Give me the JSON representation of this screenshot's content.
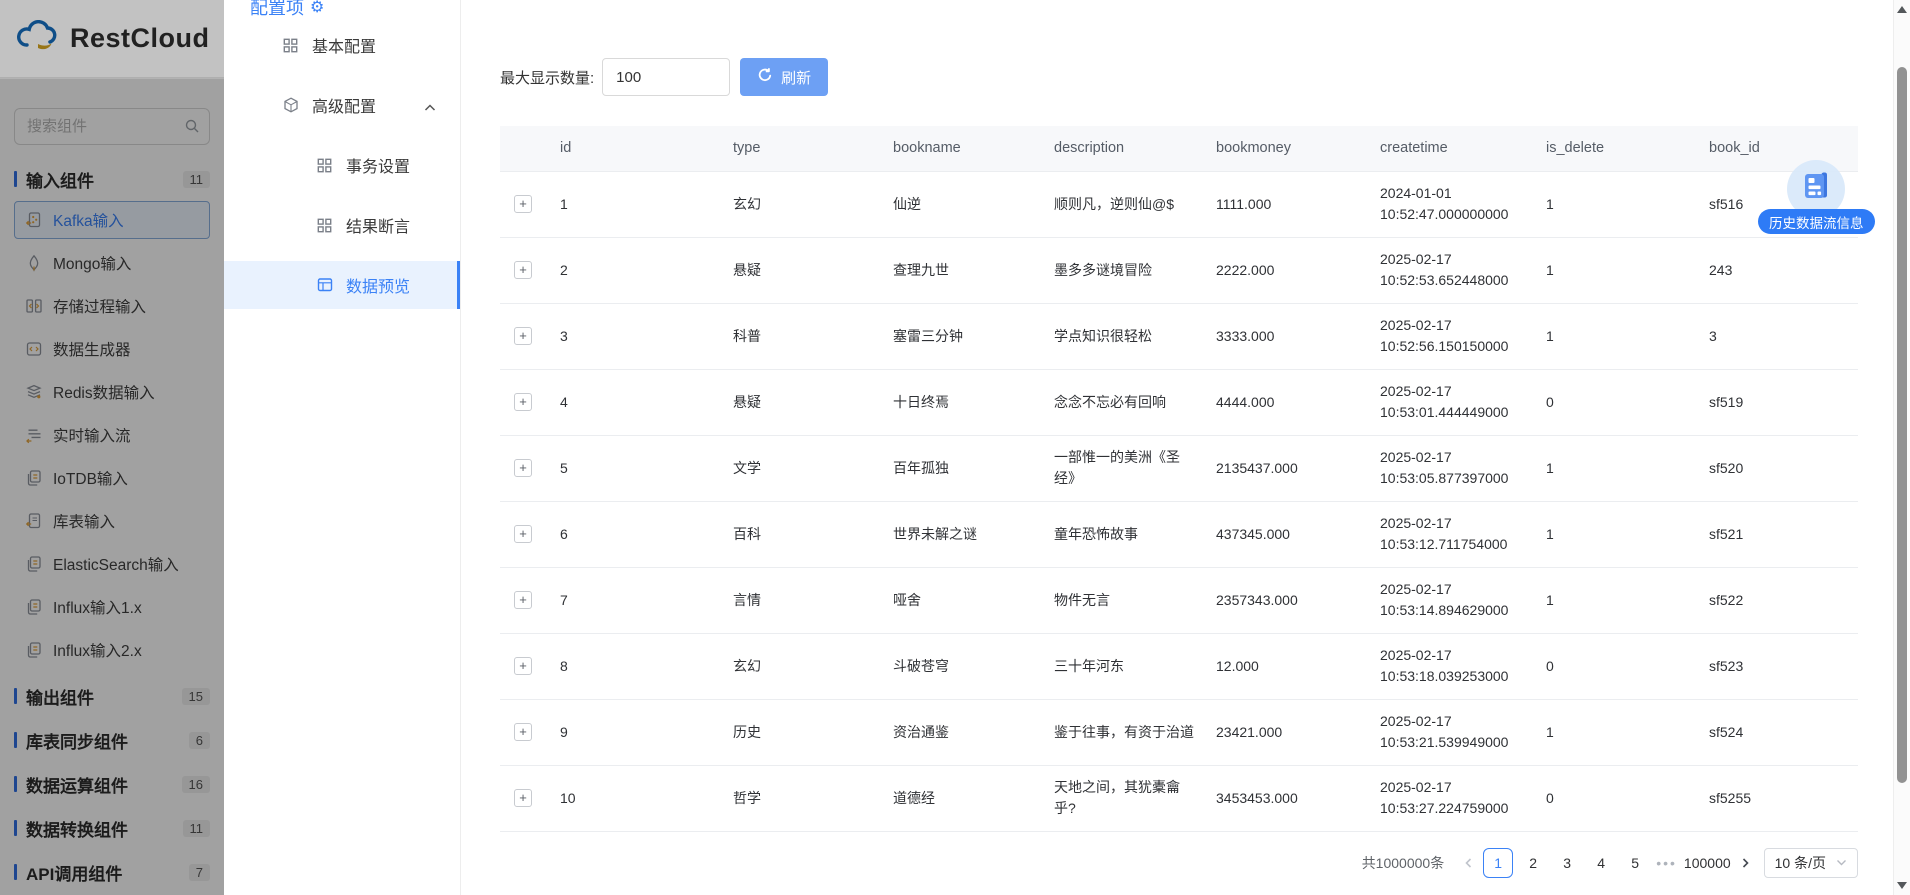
{
  "brand": {
    "name": "RestCloud"
  },
  "colors": {
    "accent_blue": "#3b82f6",
    "refresh_button_blue": "#6da0f4",
    "badge_blue": "#2e7bf6",
    "active_item_bg": "#e9f2fe",
    "table_header_bg": "#f7f8fa"
  },
  "sidebar": {
    "search_placeholder": "搜索组件",
    "sections": [
      {
        "name": "input-components",
        "label": "输入组件",
        "count": "11",
        "items": [
          {
            "name": "kafka-input",
            "label": "Kafka输入",
            "icon": "kafka-input-icon",
            "active": true
          },
          {
            "name": "mongo-input",
            "label": "Mongo输入",
            "icon": "mongo-input-icon"
          },
          {
            "name": "stored-procedure-input",
            "label": "存储过程输入",
            "icon": "stored-procedure-input-icon"
          },
          {
            "name": "data-generator",
            "label": "数据生成器",
            "icon": "data-generator-icon"
          },
          {
            "name": "redis-input",
            "label": "Redis数据输入",
            "icon": "redis-input-icon"
          },
          {
            "name": "realtime-stream-input",
            "label": "实时输入流",
            "icon": "realtime-stream-icon"
          },
          {
            "name": "iotdb-input",
            "label": "IoTDB输入",
            "icon": "iotdb-input-icon"
          },
          {
            "name": "table-input",
            "label": "库表输入",
            "icon": "table-input-icon"
          },
          {
            "name": "elasticsearch-input",
            "label": "ElasticSearch输入",
            "icon": "elasticsearch-input-icon"
          },
          {
            "name": "influx-input-1x",
            "label": "Influx输入1.x",
            "icon": "influx1-input-icon"
          },
          {
            "name": "influx-input-2x",
            "label": "Influx输入2.x",
            "icon": "influx2-input-icon"
          }
        ]
      },
      {
        "name": "output-components",
        "label": "输出组件",
        "count": "15",
        "items": []
      },
      {
        "name": "table-sync-components",
        "label": "库表同步组件",
        "count": "6",
        "items": []
      },
      {
        "name": "data-operation-components",
        "label": "数据运算组件",
        "count": "16",
        "items": []
      },
      {
        "name": "data-transform-components",
        "label": "数据转换组件",
        "count": "11",
        "items": []
      },
      {
        "name": "api-call-components",
        "label": "API调用组件",
        "count": "7",
        "items": []
      }
    ]
  },
  "config_panel": {
    "title": "配置项",
    "title_icon": "gear-icon",
    "items": [
      {
        "name": "basic-config",
        "label": "基本配置",
        "icon": "grid-icon",
        "level": 0
      },
      {
        "name": "advanced-config",
        "label": "高级配置",
        "icon": "cube-icon",
        "level": 0,
        "expandable": true,
        "expanded": true
      },
      {
        "name": "transaction-settings",
        "label": "事务设置",
        "icon": "grid-icon",
        "level": 1
      },
      {
        "name": "result-assertion",
        "label": "结果断言",
        "icon": "grid-icon",
        "level": 1
      },
      {
        "name": "data-preview",
        "label": "数据预览",
        "icon": "preview-icon",
        "level": 1,
        "active": true
      }
    ]
  },
  "toolbar": {
    "max_display_label": "最大显示数量:",
    "max_display_value": "100",
    "refresh_label": "刷新",
    "refresh_icon": "refresh-icon"
  },
  "table": {
    "columns": [
      "id",
      "type",
      "bookname",
      "description",
      "bookmoney",
      "createtime",
      "is_delete",
      "book_id"
    ],
    "expand_symbol": "+",
    "rows": [
      [
        "1",
        "玄幻",
        "仙逆",
        "顺则凡，逆则仙@$",
        "1111.000",
        "2024-01-01 10:52:47.000000000",
        "1",
        "sf516"
      ],
      [
        "2",
        "悬疑",
        "查理九世",
        "墨多多谜境冒险",
        "2222.000",
        "2025-02-17 10:52:53.652448000",
        "1",
        "243"
      ],
      [
        "3",
        "科普",
        "塞雷三分钟",
        "学点知识很轻松",
        "3333.000",
        "2025-02-17 10:52:56.150150000",
        "1",
        "3"
      ],
      [
        "4",
        "悬疑",
        "十日终焉",
        "念念不忘必有回响",
        "4444.000",
        "2025-02-17 10:53:01.444449000",
        "0",
        "sf519"
      ],
      [
        "5",
        "文学",
        "百年孤独",
        "一部惟一的美洲《圣经》",
        "2135437.000",
        "2025-02-17 10:53:05.877397000",
        "1",
        "sf520"
      ],
      [
        "6",
        "百科",
        "世界未解之谜",
        "童年恐怖故事",
        "437345.000",
        "2025-02-17 10:53:12.711754000",
        "1",
        "sf521"
      ],
      [
        "7",
        "言情",
        "哑舍",
        "物件无言",
        "2357343.000",
        "2025-02-17 10:53:14.894629000",
        "1",
        "sf522"
      ],
      [
        "8",
        "玄幻",
        "斗破苍穹",
        "三十年河东",
        "12.000",
        "2025-02-17 10:53:18.039253000",
        "0",
        "sf523"
      ],
      [
        "9",
        "历史",
        "资治通鉴",
        "鉴于往事，有资于治道",
        "23421.000",
        "2025-02-17 10:53:21.539949000",
        "1",
        "sf524"
      ],
      [
        "10",
        "哲学",
        "道德经",
        "天地之间，其犹橐龠乎?",
        "3453453.000",
        "2025-02-17 10:53:27.224759000",
        "0",
        "sf5255"
      ]
    ]
  },
  "pagination": {
    "total_label": "共1000000条",
    "current_page": "1",
    "pages": [
      "1",
      "2",
      "3",
      "4",
      "5"
    ],
    "ellipsis": "•••",
    "last_page": "100000",
    "page_size_label": "10 条/页"
  },
  "floating": {
    "icon": "history-dataflow-icon",
    "badge_label": "历史数据流信息"
  }
}
